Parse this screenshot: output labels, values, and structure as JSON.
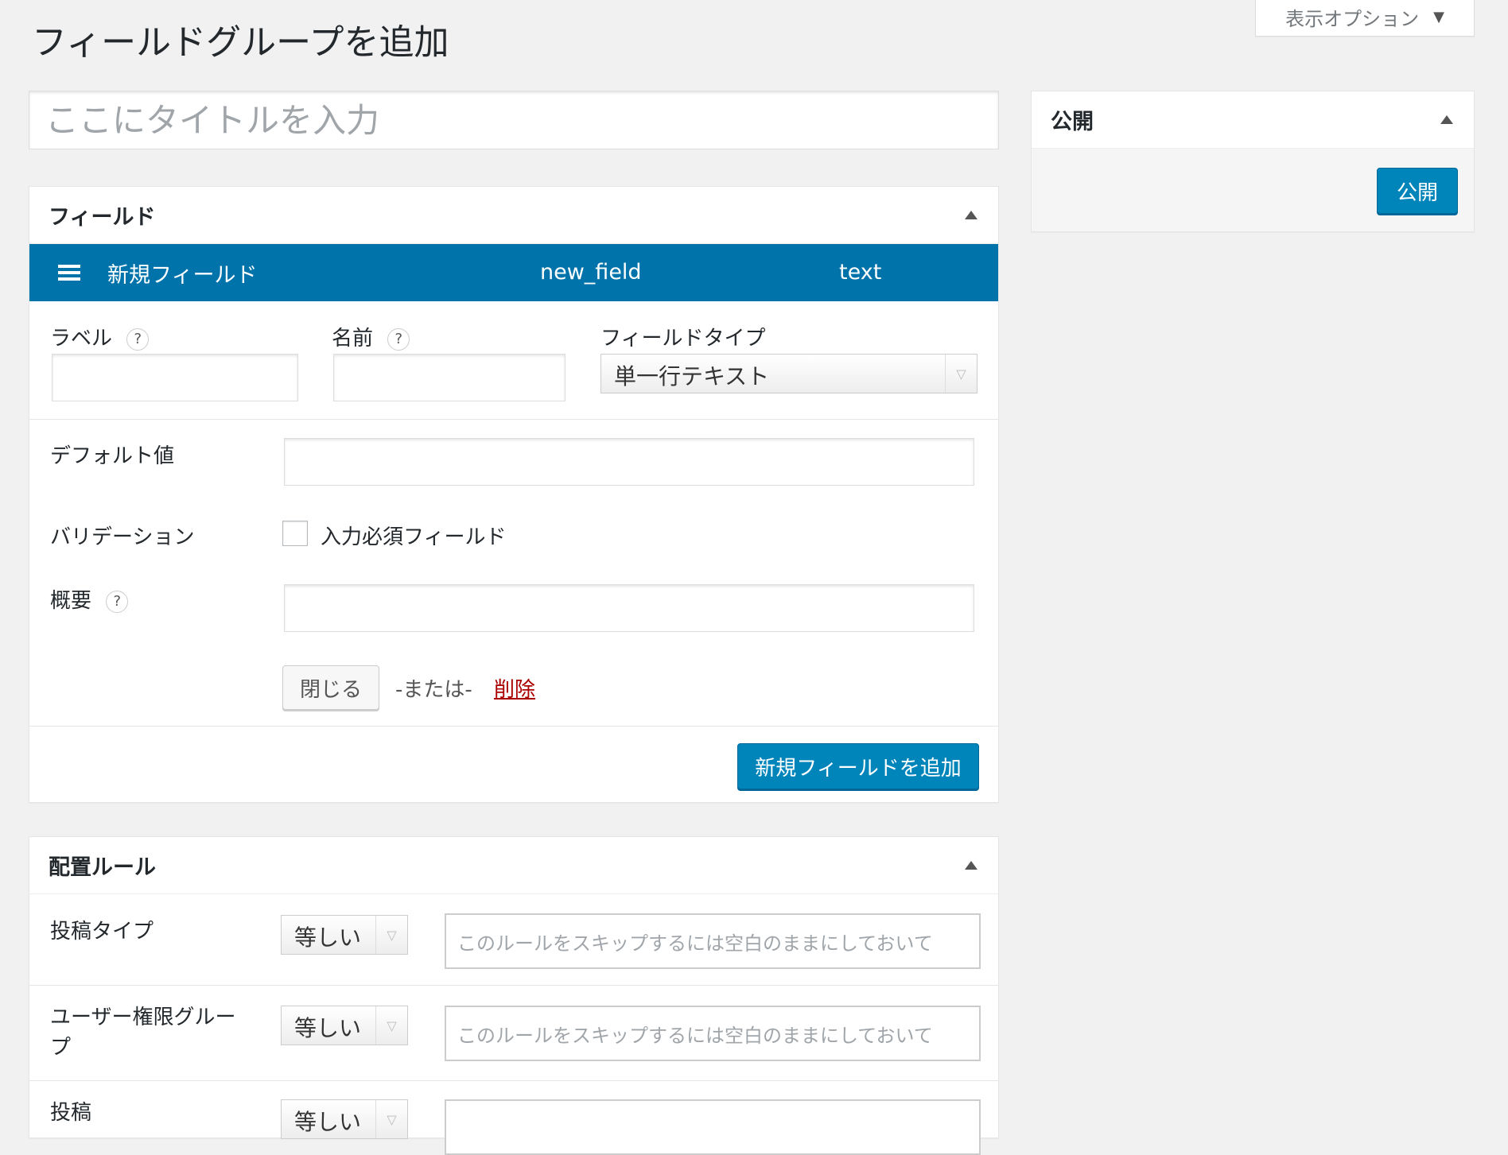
{
  "screen_options": {
    "label": "表示オプション"
  },
  "page_title": "フィールドグループを追加",
  "title_input": {
    "placeholder": "ここにタイトルを入力",
    "value": ""
  },
  "publish_box": {
    "title": "公開",
    "button": "公開"
  },
  "fields_box": {
    "title": "フィールド",
    "field": {
      "label": "新規フィールド",
      "name": "new_field",
      "type": "text"
    },
    "label_label": "ラベル",
    "name_label": "名前",
    "type_label": "フィールドタイプ",
    "type_value": "単一行テキスト",
    "default_label": "デフォルト値",
    "validation_label": "バリデーション",
    "required_label": "入力必須フィールド",
    "description_label": "概要",
    "close_button": "閉じる",
    "or_text": "-または-",
    "delete_link": "削除",
    "add_field_button": "新規フィールドを追加"
  },
  "location_box": {
    "title": "配置ルール",
    "rules": [
      {
        "label": "投稿タイプ",
        "operator": "等しい",
        "placeholder": "このルールをスキップするには空白のままにしておいて"
      },
      {
        "label": "ユーザー権限グループ",
        "operator": "等しい",
        "placeholder": "このルールをスキップするには空白のままにしておいて"
      },
      {
        "label": "投稿",
        "operator": "等しい",
        "placeholder": ""
      }
    ]
  },
  "colors": {
    "accent": "#0073aa",
    "button": "#0085ba",
    "delete": "#aa0000"
  }
}
